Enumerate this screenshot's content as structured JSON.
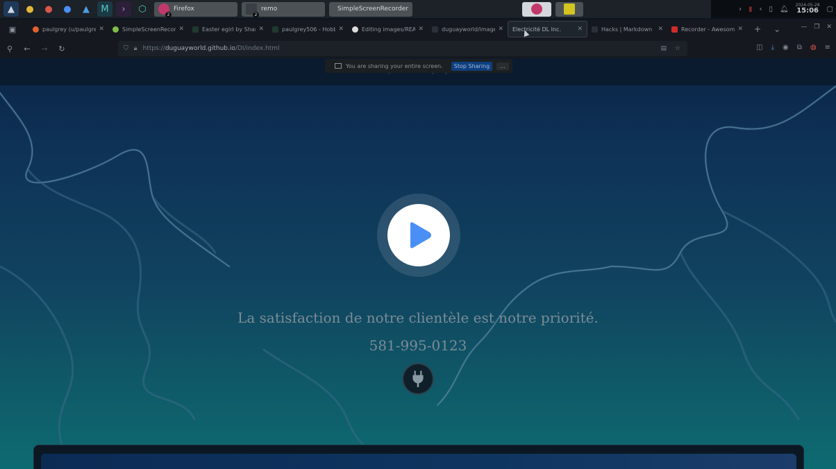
{
  "panel": {
    "tasks": [
      {
        "label": "Firefox",
        "color": "#c3386a",
        "badge": "2"
      },
      {
        "label": "remo",
        "color": "#3a3f45",
        "badge": "2"
      },
      {
        "label": "SimpleScreenRecorder",
        "color": "#d6641e"
      }
    ],
    "date": "2024-05-28",
    "time": "15:06"
  },
  "tabs": [
    {
      "label": "paulgrey (u/paulgrey)",
      "color": "#e0622e"
    },
    {
      "label": "SimpleScreenRecorder",
      "color": "#7fbf4a"
    },
    {
      "label": "Easter egirl by Shar",
      "color": "#2bc48a"
    },
    {
      "label": "paulgrey506 - Hobb",
      "color": "#2bc48a"
    },
    {
      "label": "Editing images/README",
      "color": "#dcdcdc"
    },
    {
      "label": "duguayworld/images",
      "color": "#444c55"
    },
    {
      "label": "Electricité DL Inc.",
      "color": "#2a3038",
      "active": true
    },
    {
      "label": "Hacks | Markdown",
      "color": "#444c55"
    },
    {
      "label": "Recorder - Awesome",
      "color": "#d22a2a"
    }
  ],
  "tab_controls": {
    "new_tab": "+",
    "list_tabs": "⌄"
  },
  "url": {
    "scheme": "https://",
    "host": "duguayworld.github.io",
    "path": "/DI/index.html"
  },
  "sharing": {
    "message": "You are sharing your entire screen.",
    "stop_label": "Stop Sharing",
    "more_label": "..."
  },
  "site": {
    "nav": [
      "Accueil",
      "Projets",
      "À propos",
      "Contact"
    ],
    "tagline": "La satisfaction de notre clientèle est notre priorité.",
    "phone": "581-995-0123"
  },
  "colors": {
    "play_accent": "#4a8ff5"
  }
}
